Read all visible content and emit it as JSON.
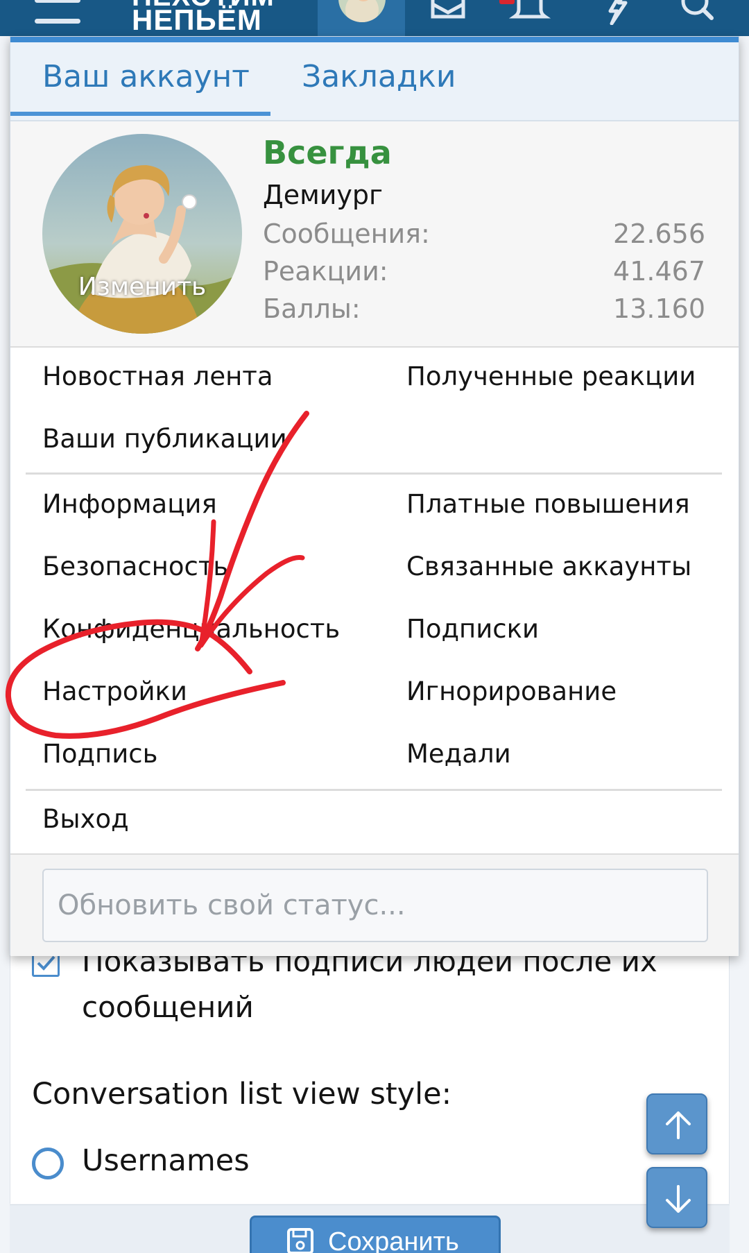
{
  "header": {
    "logo_line1": "НЕХОТИМ",
    "logo_line2": "НЕПЬЁМ",
    "icons": [
      "menu-icon",
      "inbox-icon",
      "bell-icon",
      "bolt-icon",
      "search-icon"
    ]
  },
  "menu": {
    "tabs": [
      {
        "label": "Ваш аккаунт",
        "active": true
      },
      {
        "label": "Закладки",
        "active": false
      }
    ],
    "profile": {
      "avatar_action": "Изменить",
      "username": "Всегда",
      "user_title": "Демиург",
      "stats": [
        {
          "label": "Сообщения:",
          "value": "22.656"
        },
        {
          "label": "Реакции:",
          "value": "41.467"
        },
        {
          "label": "Баллы:",
          "value": "13.160"
        }
      ]
    },
    "group1": {
      "left": [
        "Новостная лента",
        "Ваши публикации"
      ],
      "right": [
        "Полученные реакции"
      ]
    },
    "group2": {
      "left": [
        "Информация",
        "Безопасность",
        "Конфиденциальность",
        "Настройки",
        "Подпись"
      ],
      "right": [
        "Платные повышения",
        "Связанные аккаунты",
        "Подписки",
        "Игнорирование",
        "Медали"
      ]
    },
    "logout": "Выход",
    "status_placeholder": "Обновить свой статус..."
  },
  "page": {
    "checkbox_label_line1": "Показывать подписи людей после их",
    "checkbox_label_line2": "сообщений",
    "checkbox_checked": true,
    "section_label": "Conversation list view style:",
    "radio_label": "Usernames",
    "save_label": "Сохранить"
  },
  "colors": {
    "topbar": "#185886",
    "accent": "#2e79b8",
    "username": "#37913f",
    "annotation": "#e8212b"
  }
}
